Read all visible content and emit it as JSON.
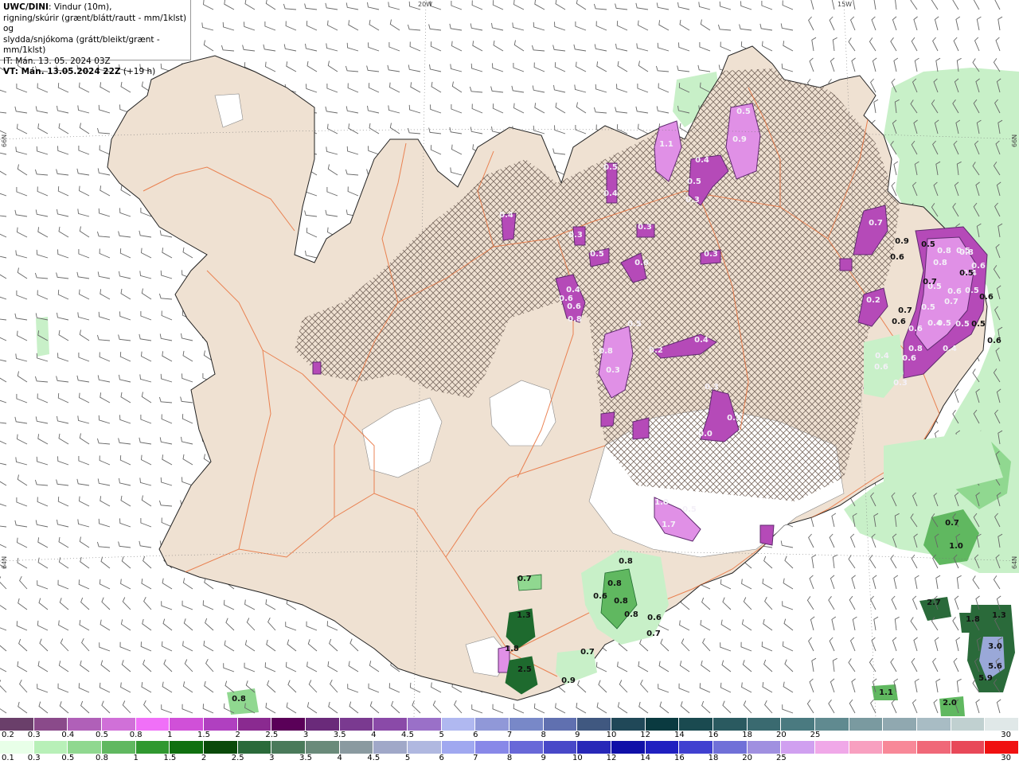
{
  "header": {
    "line1_bold": "UWC/DINI",
    "line1_rest": ": Vindur (10m),",
    "line2": "rigning/skúrir (grænt/blátt/rautt - mm/1klst) og",
    "line3": "slydda/snjókoma (grátt/bleikt/grænt - mm/1klst)",
    "line4": "IT: Mán. 13. 05. 2024 03Z",
    "line5_bold": "VT: Mán. 13.05.2024 22Z",
    "line5_rest": " (+19 h)"
  },
  "grid_labels": {
    "lon_20w": "20W",
    "lon_15w": "15W",
    "lat_66n_left": "66N",
    "lat_66n_right": "66N",
    "lat_64n_left": "64N",
    "lat_64n_right": "64N"
  },
  "colors": {
    "land": "#efe1d2",
    "glacier": "#ffffff",
    "sea": "#ffffff",
    "roads": "#e8703a",
    "coast": "#222222",
    "wind_barbs": "#555555",
    "rain_light": "#c8f0c8",
    "rain_mid": "#5fb56a",
    "rain_dark": "#1e6a2e",
    "snow_light": "#e090e6",
    "snow_mid": "#b54ab8",
    "snow_dark": "#5e2a6e"
  },
  "precip_labels": {
    "snow": [
      {
        "t": "1.1"
      },
      {
        "t": "0.5"
      },
      {
        "t": "0.9"
      },
      {
        "t": "0.4"
      },
      {
        "t": "0.5"
      },
      {
        "t": "0.3"
      },
      {
        "t": "0.5"
      },
      {
        "t": "0.4"
      },
      {
        "t": "0.3"
      },
      {
        "t": "0.4"
      },
      {
        "t": "0.3"
      },
      {
        "t": "0.5"
      },
      {
        "t": "0.4"
      },
      {
        "t": "0.6"
      },
      {
        "t": "0.3"
      },
      {
        "t": "0.6"
      },
      {
        "t": "0.6"
      },
      {
        "t": "0.8"
      },
      {
        "t": "0.5"
      },
      {
        "t": "0.2"
      },
      {
        "t": "0.4"
      },
      {
        "t": "0.8"
      },
      {
        "t": "0.3"
      },
      {
        "t": "0.3"
      },
      {
        "t": "0.0"
      },
      {
        "t": "0.3"
      },
      {
        "t": "1.0"
      },
      {
        "t": "0.5"
      },
      {
        "t": "1.7"
      },
      {
        "t": "0.7"
      },
      {
        "t": "0.2"
      },
      {
        "t": "0.4"
      },
      {
        "t": "0.6"
      },
      {
        "t": "0.3"
      },
      {
        "t": "0.8"
      },
      {
        "t": "0.8"
      },
      {
        "t": "0.5"
      },
      {
        "t": "0.6"
      },
      {
        "t": "0.5"
      },
      {
        "t": "0.5"
      },
      {
        "t": "0.7"
      },
      {
        "t": "0.5"
      },
      {
        "t": "0.4"
      },
      {
        "t": "0.5"
      },
      {
        "t": "0.6"
      },
      {
        "t": "0.8"
      },
      {
        "t": "0.6"
      },
      {
        "t": "0.4"
      },
      {
        "t": "0.4"
      },
      {
        "t": "0.6"
      },
      {
        "t": "0.5"
      },
      {
        "t": "0.8"
      }
    ],
    "rain": [
      {
        "t": "0.9"
      },
      {
        "t": "0.6"
      },
      {
        "t": "0.5"
      },
      {
        "t": "0.7"
      },
      {
        "t": "0.7"
      },
      {
        "t": "0.6"
      },
      {
        "t": "0.5"
      },
      {
        "t": "0.6"
      },
      {
        "t": "0.5"
      },
      {
        "t": "0.6"
      },
      {
        "t": "0.7"
      },
      {
        "t": "1.0"
      },
      {
        "t": "0.8"
      },
      {
        "t": "0.7"
      },
      {
        "t": "0.8"
      },
      {
        "t": "0.6"
      },
      {
        "t": "0.8"
      },
      {
        "t": "0.8"
      },
      {
        "t": "0.6"
      },
      {
        "t": "0.7"
      },
      {
        "t": "1.3"
      },
      {
        "t": "1.8"
      },
      {
        "t": "2.5"
      },
      {
        "t": "0.7"
      },
      {
        "t": "0.9"
      },
      {
        "t": "0.8"
      },
      {
        "t": "2.7"
      },
      {
        "t": "1.8"
      },
      {
        "t": "1.3"
      },
      {
        "t": "3.0"
      },
      {
        "t": "5.6"
      },
      {
        "t": "5.9"
      },
      {
        "t": "1.1"
      },
      {
        "t": "2.0"
      }
    ]
  },
  "colorbar_snow": {
    "colors": [
      "#6a3f6a",
      "#8a4a8a",
      "#b060b8",
      "#d070d8",
      "#f070f8",
      "#d050d8",
      "#b040c0",
      "#8a2a90",
      "#5a0058",
      "#6a2a7a",
      "#7a3a90",
      "#8a4aa8",
      "#9a70c8",
      "#b0b8f0",
      "#9098d8",
      "#7888c8",
      "#6070b0",
      "#405880",
      "#204858",
      "#0a3a40",
      "#1a4a50",
      "#2a5a60",
      "#3a6a70",
      "#4a7a80",
      "#608a90",
      "#7a9aa0",
      "#90a8b0",
      "#a8bcc4",
      "#c0d0d0",
      "#e0e8e8"
    ],
    "labels": [
      "0.2",
      "0.3",
      "0.4",
      "0.5",
      "0.8",
      "1",
      "1.5",
      "2",
      "2.5",
      "3",
      "3.5",
      "4",
      "4.5",
      "5",
      "6",
      "7",
      "8",
      "9",
      "10",
      "12",
      "14",
      "16",
      "18",
      "20",
      "25",
      "30"
    ]
  },
  "colorbar_rain": {
    "colors": [
      "#e8ffe8",
      "#b8f0b8",
      "#90d890",
      "#60b860",
      "#309830",
      "#107010",
      "#0a4a0a",
      "#2a6a3a",
      "#4a7a5a",
      "#6a8a7a",
      "#8a9aa0",
      "#a0a8c8",
      "#b0b8e0",
      "#a0a8f0",
      "#8888e8",
      "#6868d8",
      "#4848c8",
      "#2828b8",
      "#1010a8",
      "#2020c0",
      "#4040d0",
      "#7070d8",
      "#a090e0",
      "#d0a0f0",
      "#f0a8e8",
      "#f8a0c0",
      "#f88898",
      "#f06878",
      "#e84858",
      "#f01010"
    ],
    "labels": [
      "0.1",
      "0.3",
      "0.5",
      "0.8",
      "1",
      "1.5",
      "2",
      "2.5",
      "3",
      "3.5",
      "4",
      "4.5",
      "5",
      "6",
      "7",
      "8",
      "9",
      "10",
      "12",
      "14",
      "16",
      "18",
      "20",
      "25",
      "30"
    ]
  }
}
